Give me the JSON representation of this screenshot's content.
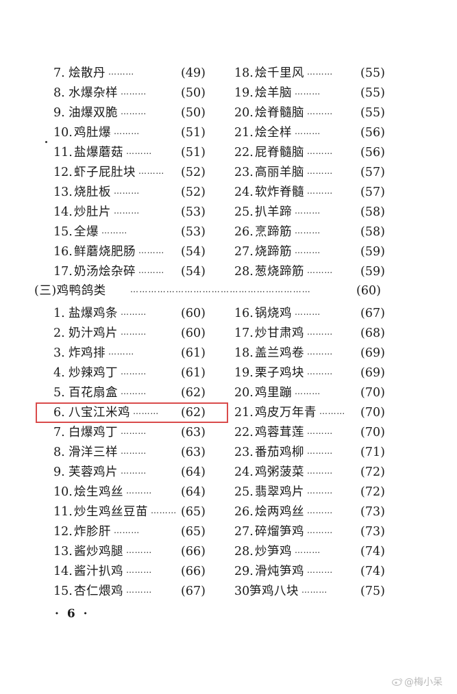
{
  "left_column": [
    {
      "num": "7.",
      "title": "烩散丹",
      "page": "(49)"
    },
    {
      "num": "8.",
      "title": "水爆杂样",
      "page": "(50)"
    },
    {
      "num": "9.",
      "title": "油爆双脆",
      "page": "(50)"
    },
    {
      "num": "10.",
      "title": "鸡肚爆",
      "page": "(51)"
    },
    {
      "num": "11.",
      "title": "盐爆蘑菇",
      "page": "(51)"
    },
    {
      "num": "12.",
      "title": "虾子屁肚块",
      "page": "(52)"
    },
    {
      "num": "13.",
      "title": "烧肚板",
      "page": "(52)"
    },
    {
      "num": "14.",
      "title": "炒肚片",
      "page": "(53)"
    },
    {
      "num": "15.",
      "title": "全爆",
      "page": "(53)"
    },
    {
      "num": "16.",
      "title": "鲜蘑烧肥肠",
      "page": "(54)"
    },
    {
      "num": "17.",
      "title": "奶汤烩杂碎",
      "page": "(54)"
    },
    {
      "num": "1.",
      "title": "盐爆鸡条",
      "page": "(60)"
    },
    {
      "num": "2.",
      "title": "奶汁鸡片",
      "page": "(60)"
    },
    {
      "num": "3.",
      "title": "炸鸡排",
      "page": "(61)"
    },
    {
      "num": "4.",
      "title": "炒辣鸡丁",
      "page": "(61)"
    },
    {
      "num": "5.",
      "title": "百花扇盒",
      "page": "(62)"
    },
    {
      "num": "6.",
      "title": "八宝江米鸡",
      "page": "(62)"
    },
    {
      "num": "7.",
      "title": "白爆鸡丁",
      "page": "(63)"
    },
    {
      "num": "8.",
      "title": "滑洋三样",
      "page": "(63)"
    },
    {
      "num": "9.",
      "title": "芙蓉鸡片",
      "page": "(64)"
    },
    {
      "num": "10.",
      "title": "烩生鸡丝",
      "page": "(64)"
    },
    {
      "num": "11.",
      "title": "炒生鸡丝豆苗",
      "page": "(65)"
    },
    {
      "num": "12.",
      "title": "炸胗肝",
      "page": "(65)"
    },
    {
      "num": "13.",
      "title": "酱炒鸡腿",
      "page": "(66)"
    },
    {
      "num": "14.",
      "title": "酱汁扒鸡",
      "page": "(66)"
    },
    {
      "num": "15.",
      "title": "杏仁煨鸡",
      "page": "(67)"
    }
  ],
  "right_column": [
    {
      "num": "18.",
      "title": "烩千里风",
      "page": "(55)"
    },
    {
      "num": "19.",
      "title": "烩羊脑",
      "page": "(55)"
    },
    {
      "num": "20.",
      "title": "烩脊髓脑",
      "page": "(55)"
    },
    {
      "num": "21.",
      "title": "烩全样",
      "page": "(56)"
    },
    {
      "num": "22.",
      "title": "屁脊髓脑",
      "page": "(56)"
    },
    {
      "num": "23.",
      "title": "高丽羊脑",
      "page": "(57)"
    },
    {
      "num": "24.",
      "title": "软炸脊髓",
      "page": "(57)"
    },
    {
      "num": "25.",
      "title": "扒羊蹄",
      "page": "(58)"
    },
    {
      "num": "26.",
      "title": "烹蹄筋",
      "page": "(58)"
    },
    {
      "num": "27.",
      "title": "烧蹄筋",
      "page": "(59)"
    },
    {
      "num": "28.",
      "title": "葱烧蹄筋",
      "page": "(59)"
    },
    {
      "num": "16.",
      "title": "锅烧鸡",
      "page": "(67)"
    },
    {
      "num": "17.",
      "title": "炒甘肃鸡",
      "page": "(68)"
    },
    {
      "num": "18.",
      "title": "盖兰鸡卷",
      "page": "(69)"
    },
    {
      "num": "19.",
      "title": "栗子鸡块",
      "page": "(69)"
    },
    {
      "num": "20.",
      "title": "鸡里蹦",
      "page": "(70)"
    },
    {
      "num": "21.",
      "title": "鸡皮万年青",
      "page": "(70)"
    },
    {
      "num": "22.",
      "title": "鸡蓉茸莲",
      "page": "(70)"
    },
    {
      "num": "23.",
      "title": "番茄鸡柳",
      "page": "(71)"
    },
    {
      "num": "24.",
      "title": "鸡粥菠菜",
      "page": "(72)"
    },
    {
      "num": "25.",
      "title": "翡翠鸡片",
      "page": "(72)"
    },
    {
      "num": "26.",
      "title": "烩两鸡丝",
      "page": "(73)"
    },
    {
      "num": "27.",
      "title": "碎熘笋鸡",
      "page": "(73)"
    },
    {
      "num": "28.",
      "title": "炒笋鸡",
      "page": "(74)"
    },
    {
      "num": "29.",
      "title": "滑炖笋鸡",
      "page": "(74)"
    },
    {
      "num": "30",
      "title": "笋鸡八块",
      "page": "(75)"
    }
  ],
  "section": {
    "title": "(三)鸡鸭鸽类",
    "page": "(60)"
  },
  "footer": {
    "page_number": "· 6 ·"
  },
  "watermark": {
    "text": "@梅小呆"
  },
  "highlight": {
    "color": "#d94a4a"
  },
  "dot_leader": "………",
  "section_dot_leader": "……………………………………………………"
}
